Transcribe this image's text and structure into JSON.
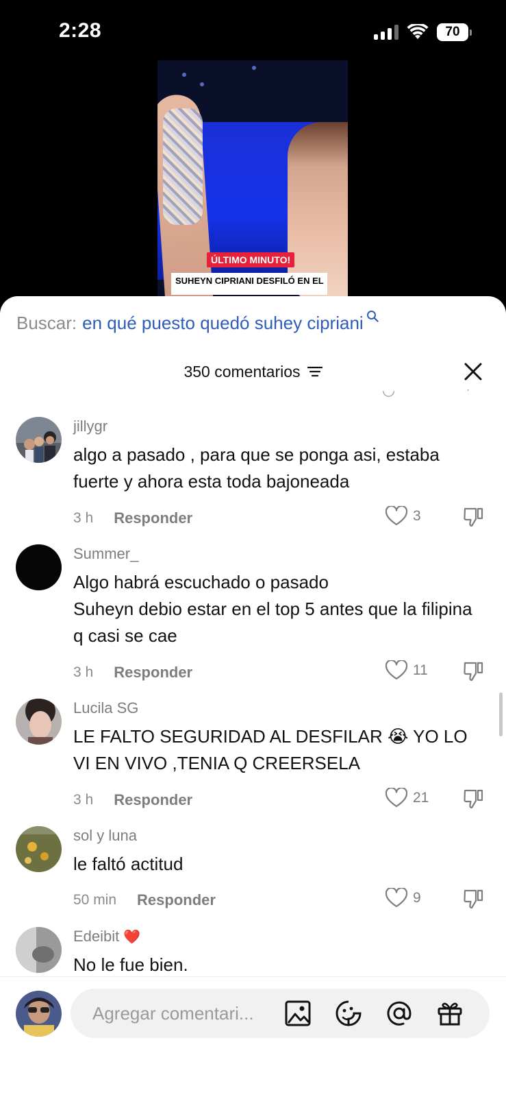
{
  "status_bar": {
    "time": "2:28",
    "battery": "70"
  },
  "video": {
    "badge": "ÚLTIMO MINUTO!",
    "caption": "SUHEYN CIPRIANI DESFILÓ EN EL"
  },
  "search": {
    "label": "Buscar:",
    "query": "en qué puesto quedó suhey cipriani"
  },
  "comments_header": {
    "title": "350 comentarios"
  },
  "comments": [
    {
      "user": "jillygr",
      "text": "algo a pasado , para que se ponga asi, estaba fuerte y ahora esta toda bajoneada",
      "time": "3 h",
      "reply": "Responder",
      "likes": "3"
    },
    {
      "user": "Summer_",
      "text": "Algo habrá escuchado o pasado\nSuheyn debio estar en el top 5 antes que la filipina q casi se cae",
      "time": "3 h",
      "reply": "Responder",
      "likes": "11"
    },
    {
      "user": "Lucila SG",
      "text": "LE FALTO SEGURIDAD AL DESFILAR 😭 YO LO VI EN VIVO ,TENIA Q CREERSELA",
      "time": "3 h",
      "reply": "Responder",
      "likes": "21"
    },
    {
      "user": "sol y luna",
      "text": "le faltó actitud",
      "time": "50 min",
      "reply": "Responder",
      "likes": "9"
    },
    {
      "user": "Edeibit",
      "user_badge": "❤️",
      "text": "No le fue bien."
    }
  ],
  "input": {
    "placeholder": "Agregar comentari..."
  },
  "colors": {
    "link": "#2e5cb8",
    "muted": "#8a8a8a",
    "text": "#111111"
  },
  "icons": [
    "search-icon",
    "filter-icon",
    "close-icon",
    "heart-icon",
    "dislike-icon",
    "image-icon",
    "sticker-icon",
    "mention-icon",
    "gift-icon"
  ]
}
